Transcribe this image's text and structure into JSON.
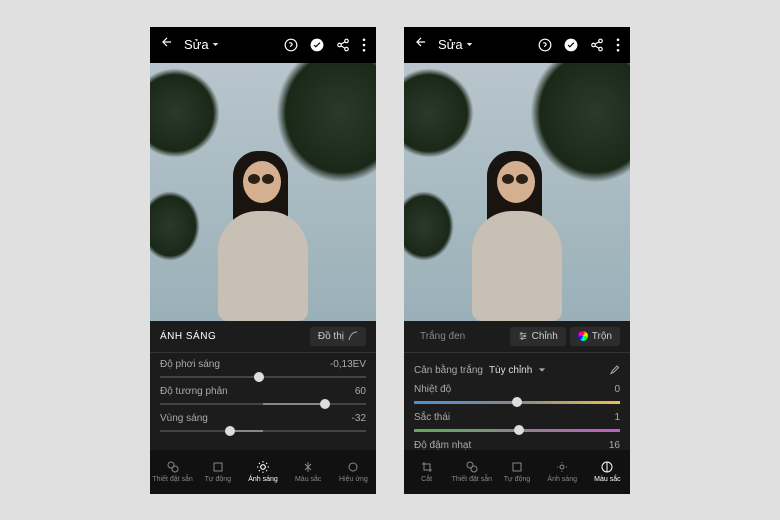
{
  "common": {
    "title": "Sửa",
    "photo_alt": "portrait woman sunglasses trees"
  },
  "left": {
    "panel": {
      "title": "ÁNH SÁNG",
      "button": "Đồ thị",
      "sliders": [
        {
          "label": "Độ phơi sáng",
          "value": "-0,13EV",
          "pos": 48
        },
        {
          "label": "Độ tương phản",
          "value": "60",
          "pos": 80
        },
        {
          "label": "Vùng sáng",
          "value": "-32",
          "pos": 34
        }
      ]
    },
    "tabs": [
      "Thiết đặt sẵn",
      "Tự động",
      "Ánh sáng",
      "Màu sắc",
      "Hiệu ứng"
    ],
    "active_tab": 2
  },
  "right": {
    "panel": {
      "bw_label": "Trắng đen",
      "adjust_button": "Chỉnh",
      "mix_button": "Trộn",
      "wb_label": "Cân bằng trắng",
      "wb_value": "Tùy chỉnh",
      "sliders": [
        {
          "label": "Nhiệt độ",
          "value": "0",
          "pos": 50,
          "track": "temp"
        },
        {
          "label": "Sắc thái",
          "value": "1",
          "pos": 51,
          "track": "tint"
        },
        {
          "label": "Độ đậm nhạt",
          "value": "16",
          "pos": 58,
          "track": "plain"
        }
      ]
    },
    "tabs": [
      "Cắt",
      "Thiết đặt sẵn",
      "Tự động",
      "Ánh sáng",
      "Màu sắc"
    ],
    "active_tab": 4
  }
}
